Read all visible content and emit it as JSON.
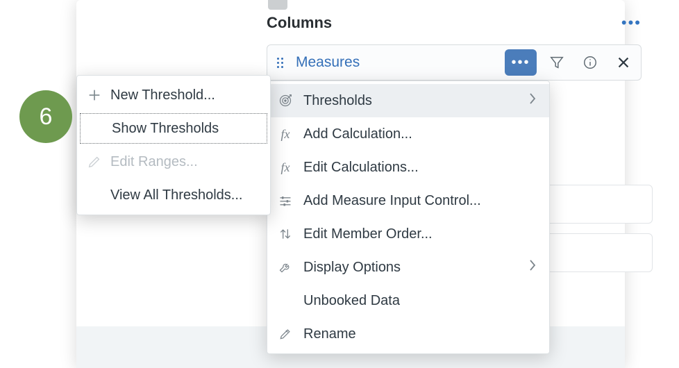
{
  "step_badge": "6",
  "columns": {
    "title": "Columns",
    "token": {
      "label": "Measures"
    }
  },
  "menu": {
    "items": [
      {
        "label": "Thresholds",
        "icon": "target",
        "has_sub": true,
        "highlight": true
      },
      {
        "label": "Add Calculation...",
        "icon": "fx"
      },
      {
        "label": "Edit Calculations...",
        "icon": "fx"
      },
      {
        "label": "Add Measure Input Control...",
        "icon": "sliders"
      },
      {
        "label": "Edit Member Order...",
        "icon": "updown"
      },
      {
        "label": "Display Options",
        "icon": "wrench",
        "has_sub": true
      },
      {
        "label": "Unbooked Data",
        "icon": ""
      },
      {
        "label": "Rename",
        "icon": "pencil"
      }
    ]
  },
  "submenu": {
    "items": [
      {
        "label": "New Threshold...",
        "icon": "plus"
      },
      {
        "label": "Show Thresholds",
        "icon": "",
        "selected": true
      },
      {
        "label": "Edit Ranges...",
        "icon": "pencil",
        "disabled": true
      },
      {
        "label": "View All Thresholds...",
        "icon": ""
      }
    ]
  }
}
